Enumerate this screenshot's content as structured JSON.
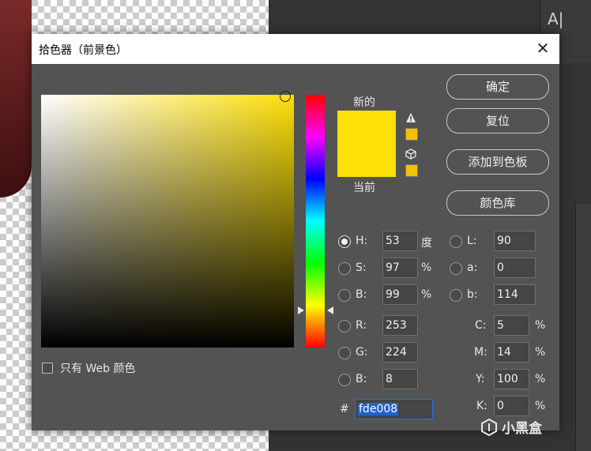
{
  "dialog": {
    "title": "拾色器（前景色）",
    "close_label": "✕"
  },
  "buttons": {
    "ok": "确定",
    "reset": "复位",
    "add_to_swatches": "添加到色板",
    "color_libraries": "颜色库"
  },
  "swatch": {
    "new_label": "新的",
    "current_label": "当前",
    "new_color": "#fde008",
    "current_color": "#fde008",
    "gamut_warning_color": "#f2c100",
    "web_safe_color": "#f2c100"
  },
  "web_only_label": "只有 Web 颜色",
  "hsb": {
    "h_label": "H:",
    "h": "53",
    "h_unit": "度",
    "s_label": "S:",
    "s": "97",
    "s_unit": "%",
    "b_label": "B:",
    "b": "99",
    "b_unit": "%"
  },
  "lab": {
    "l_label": "L:",
    "l": "90",
    "a_label": "a:",
    "a": "0",
    "b_label": "b:",
    "b": "114"
  },
  "rgb": {
    "r_label": "R:",
    "r": "253",
    "g_label": "G:",
    "g": "224",
    "b_label": "B:",
    "b": "8"
  },
  "cmyk": {
    "c_label": "C:",
    "c": "5",
    "m_label": "M:",
    "m": "14",
    "y_label": "Y:",
    "y": "100",
    "k_label": "K:",
    "k": "0",
    "unit": "%"
  },
  "hex": {
    "label": "#",
    "value": "fde008"
  },
  "background": {
    "text_tool": "A|"
  },
  "watermark": "小黑盒"
}
